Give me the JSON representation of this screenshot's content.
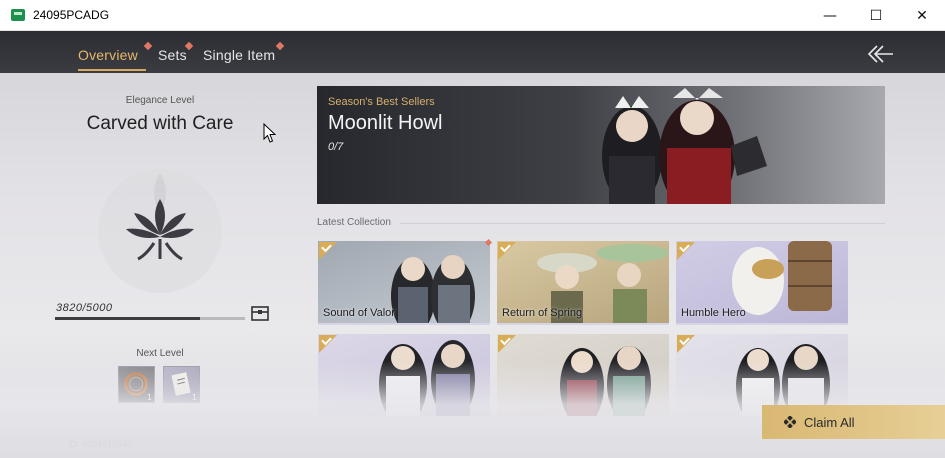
{
  "window": {
    "title": "24095PCADG",
    "minimize": "—",
    "maximize": "☐",
    "close": "✕"
  },
  "tabs": [
    {
      "label": "Overview",
      "active": true
    },
    {
      "label": "Sets",
      "active": false
    },
    {
      "label": "Single Item",
      "active": false
    }
  ],
  "left_panel": {
    "elegance_label": "Elegance Level",
    "elegance_title": "Carved with Care",
    "progress_text": "3820/5000",
    "progress_fraction": 0.764,
    "next_level_label": "Next Level",
    "rewards": [
      {
        "icon": "ring-icon",
        "count": "1"
      },
      {
        "icon": "scroll-icon",
        "count": "1"
      }
    ],
    "player_id": "ID: 4094913547"
  },
  "banner": {
    "subtitle": "Season's Best Sellers",
    "title": "Moonlit Howl",
    "count": "0/7"
  },
  "latest": {
    "label": "Latest Collection",
    "cards": [
      {
        "name": "Sound of Valor",
        "checked": true
      },
      {
        "name": "Return of Spring",
        "checked": true
      },
      {
        "name": "Humble Hero",
        "checked": true
      },
      {
        "name": "",
        "checked": true
      },
      {
        "name": "",
        "checked": true
      },
      {
        "name": "",
        "checked": true
      }
    ]
  },
  "claim": {
    "label": "Claim All"
  },
  "colors": {
    "accent_gold": "#e6b869",
    "notify_dot": "#e07963",
    "claim_bg": "#d9b872"
  }
}
